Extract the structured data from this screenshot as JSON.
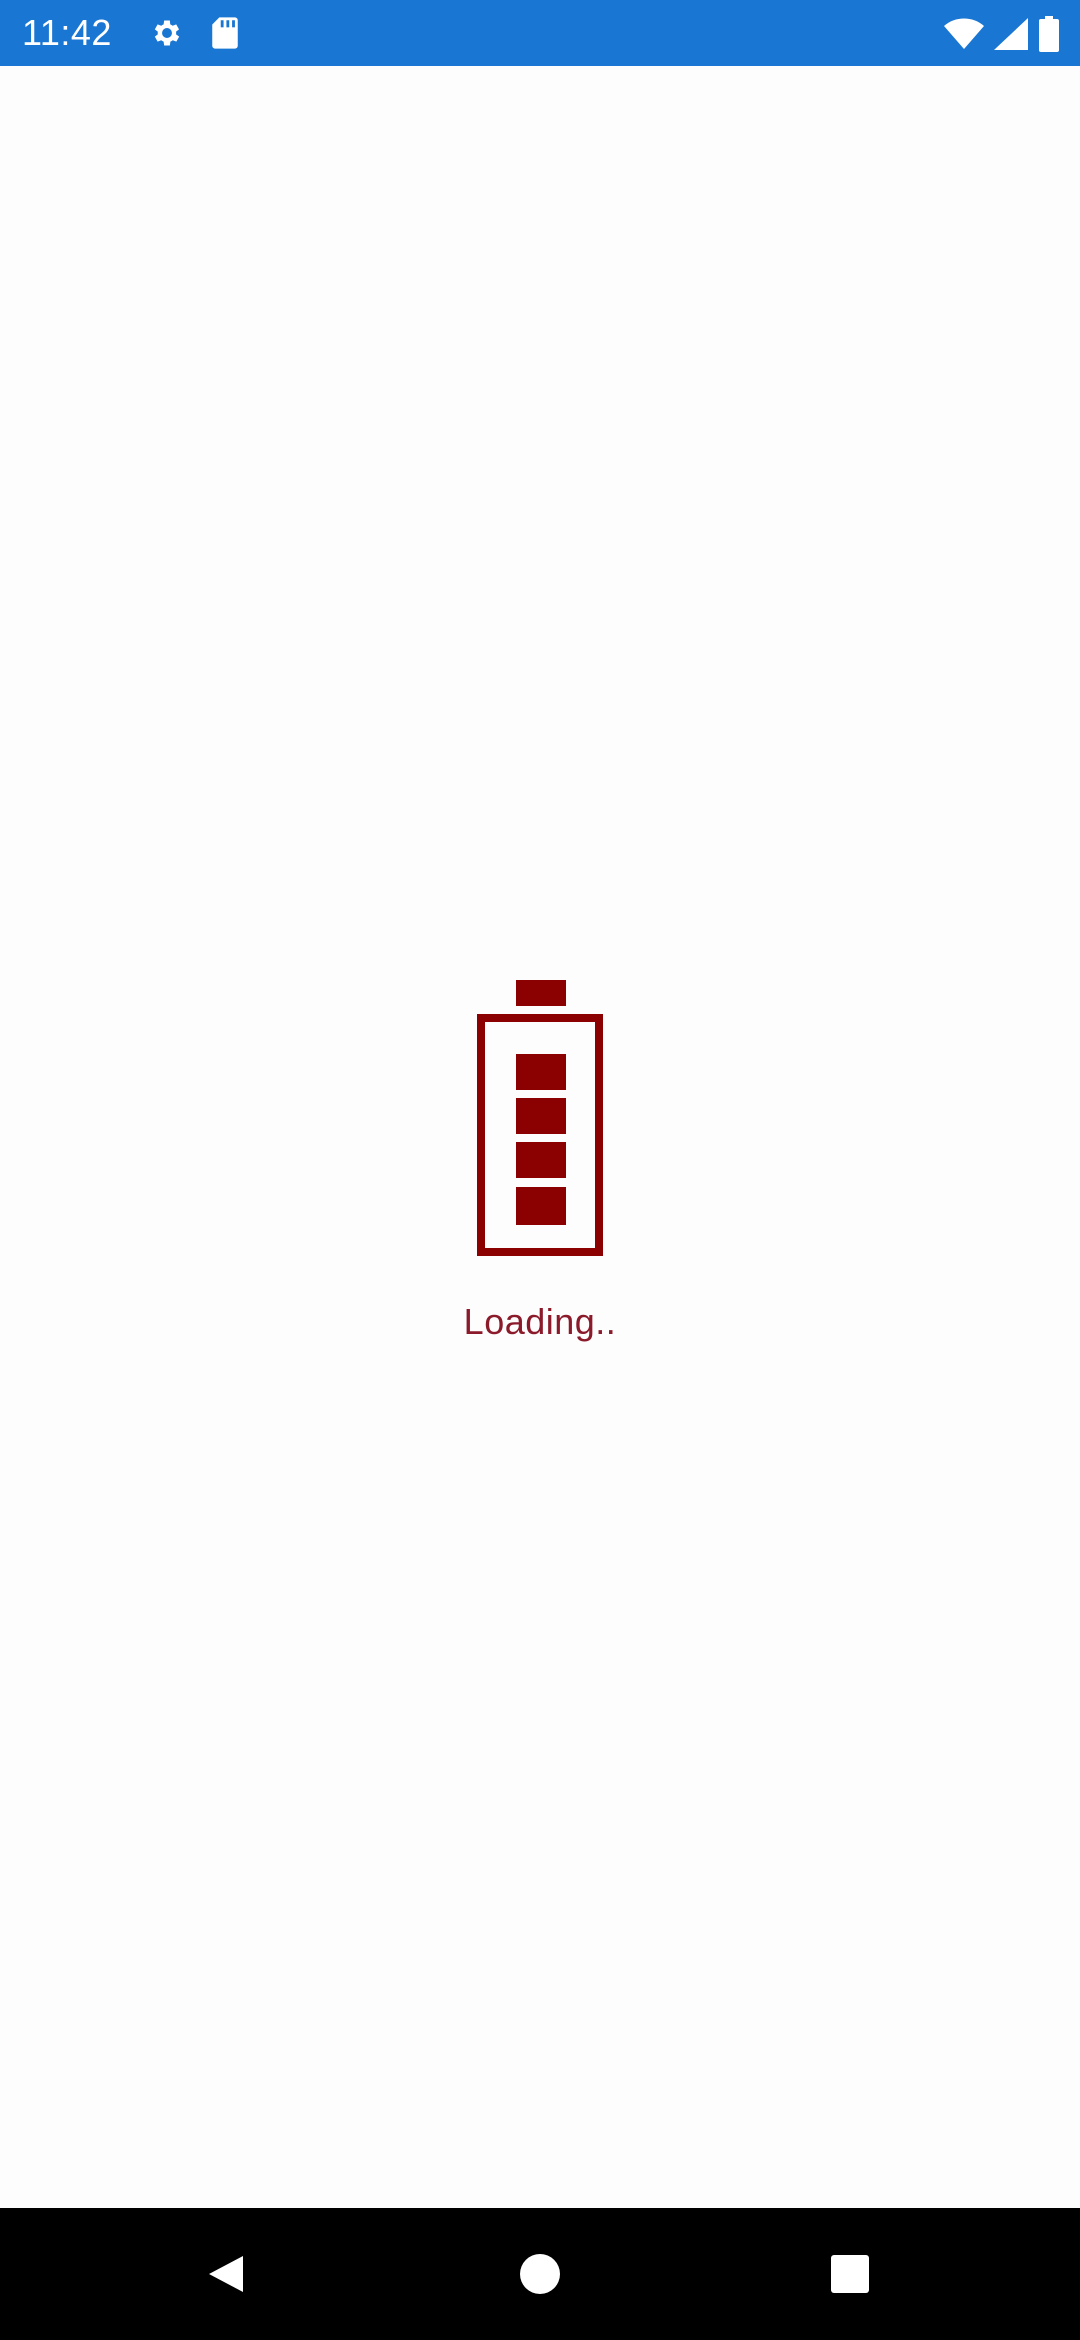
{
  "status_bar": {
    "time": "11:42",
    "background_color": "#1976d2",
    "left_icons": [
      "settings-gear-icon",
      "sd-card-icon"
    ],
    "right_icons": [
      "wifi-icon",
      "cell-signal-icon",
      "battery-icon"
    ]
  },
  "loader": {
    "icon": "battery-loading-icon",
    "icon_color": "#8b0000",
    "battery_segments_filled": 4,
    "text": "Loading.."
  },
  "nav_bar": {
    "buttons": [
      "back-icon",
      "home-icon",
      "recents-icon"
    ]
  }
}
